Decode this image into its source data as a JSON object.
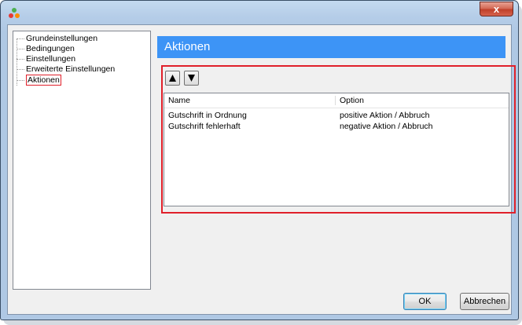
{
  "window": {
    "icon": "app-logo-icon",
    "close_label": "x"
  },
  "tree": {
    "items": [
      {
        "label": "Grundeinstellungen"
      },
      {
        "label": "Bedingungen"
      },
      {
        "label": "Einstellungen"
      },
      {
        "label": "Erweiterte Einstellungen"
      },
      {
        "label": "Aktionen",
        "selected": true
      }
    ]
  },
  "panel": {
    "title": "Aktionen",
    "title_bg": "#3d94f6",
    "highlight_color": "#e0202a"
  },
  "toolbar": {
    "up_icon": "arrow-up-icon",
    "down_icon": "arrow-down-icon"
  },
  "table": {
    "columns": [
      "Name",
      "Option"
    ],
    "rows": [
      {
        "name": "Gutschrift in Ordnung",
        "option": "positive Aktion / Abbruch"
      },
      {
        "name": "Gutschrift fehlerhaft",
        "option": "negative Aktion / Abbruch"
      }
    ]
  },
  "footer": {
    "ok_label": "OK",
    "cancel_label": "Abbrechen"
  }
}
